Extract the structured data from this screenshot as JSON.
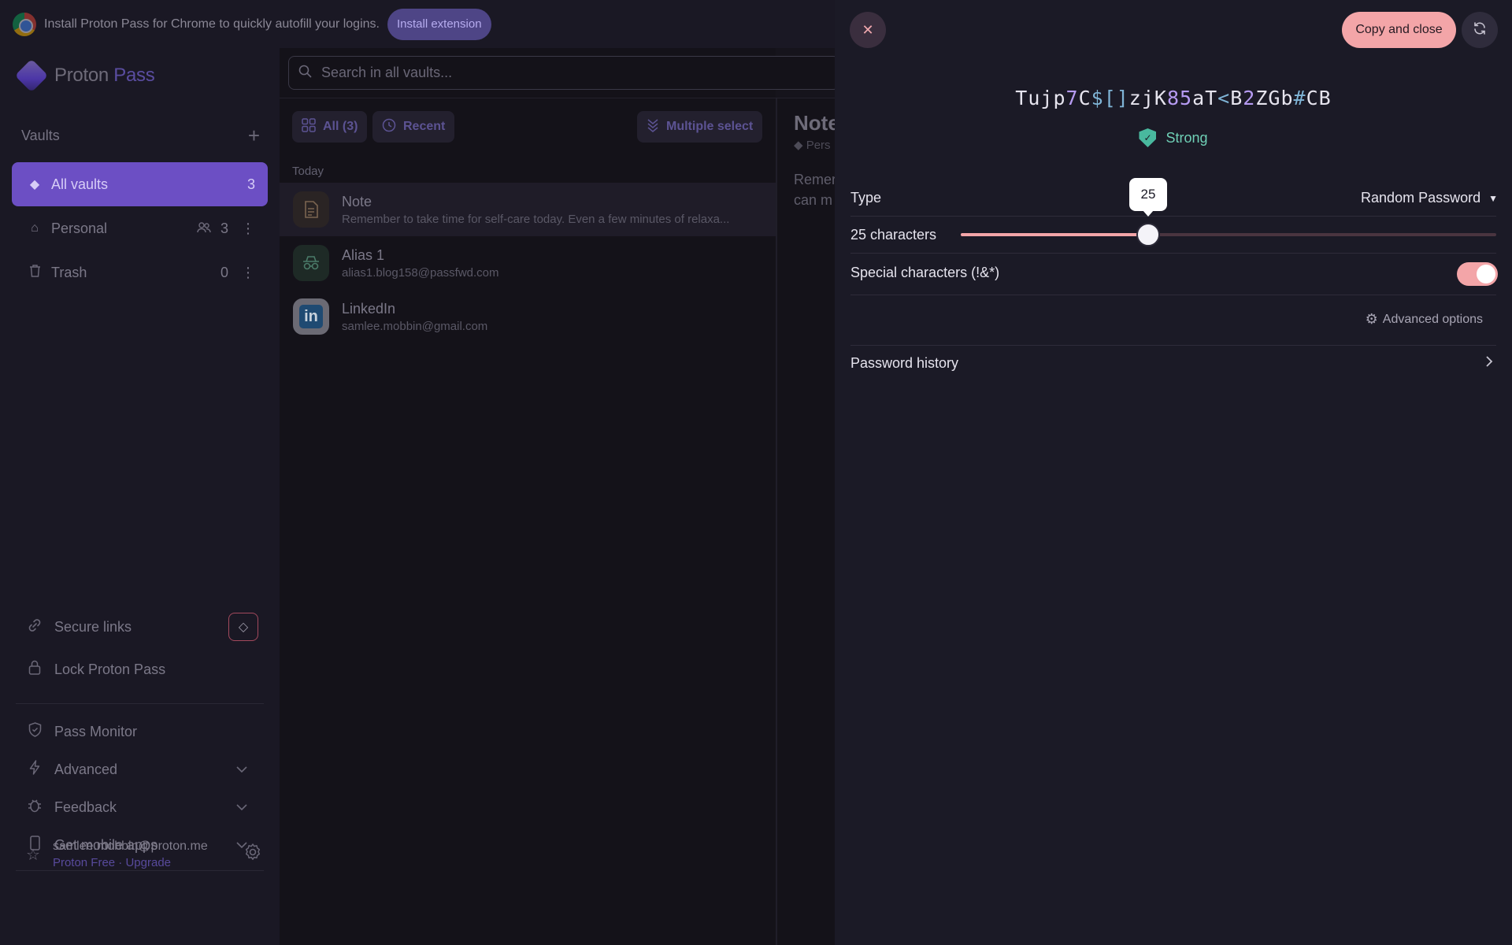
{
  "banner": {
    "text": "Install Proton Pass for Chrome to quickly autofill your logins.",
    "button_label": "Install extension"
  },
  "sidebar": {
    "logo_text_a": "Proton",
    "logo_text_b": "Pass",
    "vaults_title": "Vaults",
    "vaults": [
      {
        "label": "All vaults",
        "count": "3"
      },
      {
        "label": "Personal",
        "count": "3"
      },
      {
        "label": "Trash",
        "count": "0"
      }
    ],
    "secure_links": "Secure links",
    "lock": "Lock Proton Pass",
    "pass_monitor": "Pass Monitor",
    "advanced": "Advanced",
    "feedback": "Feedback",
    "mobile_apps": "Get mobile apps",
    "account": {
      "email": "samlee.mobbin@proton.me",
      "plan": "Proton Free · Upgrade"
    }
  },
  "list": {
    "search_placeholder": "Search in all vaults...",
    "filter_all": "All (3)",
    "filter_recent": "Recent",
    "multiple_select": "Multiple select",
    "day": "Today",
    "items": [
      {
        "title": "Note",
        "subtitle": "Remember to take time for self-care today. Even a few minutes of relaxa..."
      },
      {
        "title": "Alias 1",
        "subtitle": "alias1.blog158@passfwd.com"
      },
      {
        "title": "LinkedIn",
        "subtitle": "samlee.mobbin@gmail.com"
      }
    ]
  },
  "detail": {
    "title": "Note",
    "vault": "Pers",
    "body_line1": "Remer",
    "body_line2": "can m"
  },
  "generator": {
    "copy_label": "Copy and close",
    "password_parts": [
      {
        "t": "Tujp",
        "k": "l"
      },
      {
        "t": "7",
        "k": "n"
      },
      {
        "t": "C",
        "k": "l"
      },
      {
        "t": "$[]",
        "k": "s"
      },
      {
        "t": "zjK",
        "k": "l"
      },
      {
        "t": "85",
        "k": "n"
      },
      {
        "t": "aT",
        "k": "l"
      },
      {
        "t": "<",
        "k": "s"
      },
      {
        "t": "B",
        "k": "l"
      },
      {
        "t": "2",
        "k": "n"
      },
      {
        "t": "ZGb",
        "k": "l"
      },
      {
        "t": "#",
        "k": "s"
      },
      {
        "t": "CB",
        "k": "l"
      }
    ],
    "strength": "Strong",
    "type_label": "Type",
    "type_value": "Random Password",
    "length_label": "25 characters",
    "length_value": 25,
    "length_fraction": 0.35,
    "length_tooltip": "25",
    "special_label": "Special characters (!&*)",
    "special_enabled": true,
    "advanced_options": "Advanced options",
    "history": "Password history"
  },
  "colors": {
    "accent": "#6c4fc4",
    "primary_button": "#f3a5a8",
    "strong": "#6fd0b6"
  }
}
